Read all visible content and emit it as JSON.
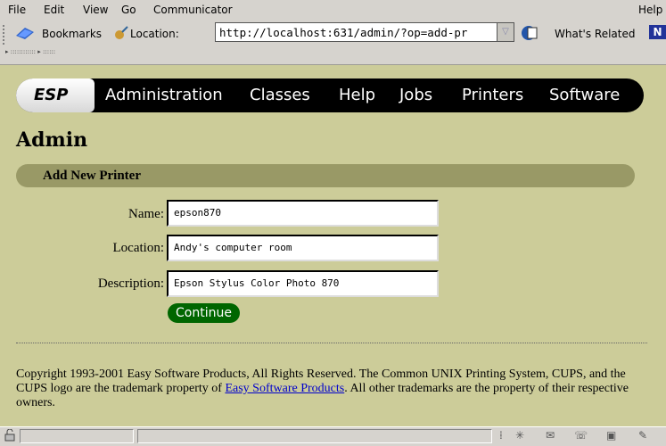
{
  "menu": {
    "file": "File",
    "edit": "Edit",
    "view": "View",
    "go": "Go",
    "communicator": "Communicator",
    "help": "Help"
  },
  "toolbar": {
    "bookmarks": "Bookmarks",
    "location_label": "Location:",
    "location_value": "http://localhost:631/admin/?op=add-pr",
    "whats_related": "What's Related"
  },
  "nav": {
    "logo": "ESP",
    "items": [
      "Administration",
      "Classes",
      "Help",
      "Jobs",
      "Printers",
      "Software"
    ]
  },
  "page": {
    "title": "Admin",
    "section": "Add New Printer"
  },
  "form": {
    "name_label": "Name:",
    "name_value": "epson870",
    "location_label": "Location:",
    "location_value": "Andy's computer room",
    "description_label": "Description:",
    "description_value": "Epson Stylus Color Photo 870",
    "continue_label": "Continue"
  },
  "footer": {
    "text_before": "Copyright 1993-2001 Easy Software Products, All Rights Reserved. The Common UNIX Printing System, CUPS, and the CUPS logo are the trademark property of ",
    "link": "Easy Software Products",
    "text_after": ". All other trademarks are the property of their respective owners."
  },
  "colors": {
    "background": "#cccc99",
    "section_bar": "#999966",
    "button": "#006600",
    "nav": "#000000"
  }
}
